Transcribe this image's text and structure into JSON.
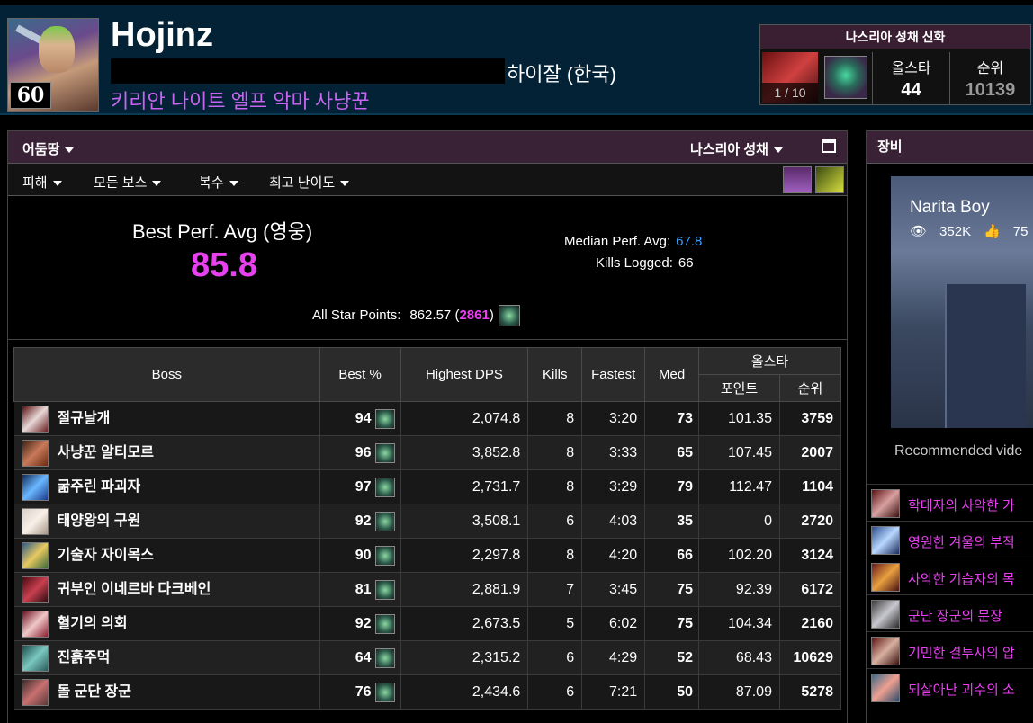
{
  "header": {
    "character_name": "Hojinz",
    "level": "60",
    "realm": "하이잘 (한국)",
    "class_line": "키리안 나이트 엘프 악마 사냥꾼",
    "raid": {
      "title": "나스리아 성채 신화",
      "progress": "1 / 10",
      "allstar_label": "올스타",
      "allstar_value": "44",
      "rank_label": "순위",
      "rank_value": "10139"
    }
  },
  "toolbar1": {
    "zone_filter": "어둠땅",
    "raid_filter": "나스리아 성채"
  },
  "toolbar2": {
    "metric": "피해",
    "bosses": "모든 보스",
    "mode": "복수",
    "difficulty": "최고 난이도"
  },
  "summary": {
    "best_perf_label": "Best Perf. Avg (영웅)",
    "best_perf_value": "85.8",
    "median_label": "Median Perf. Avg:",
    "median_value": "67.8",
    "kills_label": "Kills Logged:",
    "kills_value": "66",
    "allstar_label": "All Star Points:",
    "allstar_points": "862.57",
    "allstar_paren_open": "(",
    "allstar_rank": "2861",
    "allstar_paren_close": ")"
  },
  "table": {
    "headers": {
      "boss": "Boss",
      "best": "Best %",
      "dps": "Highest DPS",
      "kills": "Kills",
      "fastest": "Fastest",
      "med": "Med",
      "allstar": "올스타",
      "points": "포인트",
      "rank": "순위"
    },
    "rows": [
      {
        "boss": "절규날개",
        "best": "94",
        "dps": "2,074.8",
        "kills": "8",
        "fastest": "3:20",
        "med": "73",
        "points": "101.35",
        "rank": "3759"
      },
      {
        "boss": "사냥꾼 알티모르",
        "best": "96",
        "dps": "3,852.8",
        "kills": "8",
        "fastest": "3:33",
        "med": "65",
        "points": "107.45",
        "rank": "2007"
      },
      {
        "boss": "굶주린 파괴자",
        "best": "97",
        "dps": "2,731.7",
        "kills": "8",
        "fastest": "3:29",
        "med": "79",
        "points": "112.47",
        "rank": "1104"
      },
      {
        "boss": "태양왕의 구원",
        "best": "92",
        "dps": "3,508.1",
        "kills": "6",
        "fastest": "4:03",
        "med": "35",
        "points": "0",
        "rank": "2720"
      },
      {
        "boss": "기술자 자이목스",
        "best": "90",
        "dps": "2,297.8",
        "kills": "8",
        "fastest": "4:20",
        "med": "66",
        "points": "102.20",
        "rank": "3124"
      },
      {
        "boss": "귀부인 이네르바 다크베인",
        "best": "81",
        "dps": "2,881.9",
        "kills": "7",
        "fastest": "3:45",
        "med": "75",
        "points": "92.39",
        "rank": "6172"
      },
      {
        "boss": "혈기의 의회",
        "best": "92",
        "dps": "2,673.5",
        "kills": "5",
        "fastest": "6:02",
        "med": "75",
        "points": "104.34",
        "rank": "2160"
      },
      {
        "boss": "진흙주먹",
        "best": "64",
        "dps": "2,315.2",
        "kills": "6",
        "fastest": "4:29",
        "med": "52",
        "points": "68.43",
        "rank": "10629"
      },
      {
        "boss": "돌 군단 장군",
        "best": "76",
        "dps": "2,434.6",
        "kills": "6",
        "fastest": "7:21",
        "med": "50",
        "points": "87.09",
        "rank": "5278"
      }
    ]
  },
  "side": {
    "title": "장비",
    "video_title": "Narita Boy",
    "video_views": "352K",
    "video_likes": "75",
    "recommended": "Recommended vide",
    "gear": [
      {
        "name": "학대자의 사악한 가"
      },
      {
        "name": "영원한 겨울의 부적"
      },
      {
        "name": "사악한 기습자의 목"
      },
      {
        "name": "군단 장군의 문장"
      },
      {
        "name": "기민한 결투사의 압"
      },
      {
        "name": "되살아난 괴수의 소"
      }
    ]
  },
  "colors": {
    "pink": "#e840f0",
    "orange": "#ff9a20",
    "blue": "#2a9aff",
    "green": "#28e028",
    "gold": "#ffb040",
    "header_bg": "#032235",
    "bar_bg": "#3a2236"
  }
}
